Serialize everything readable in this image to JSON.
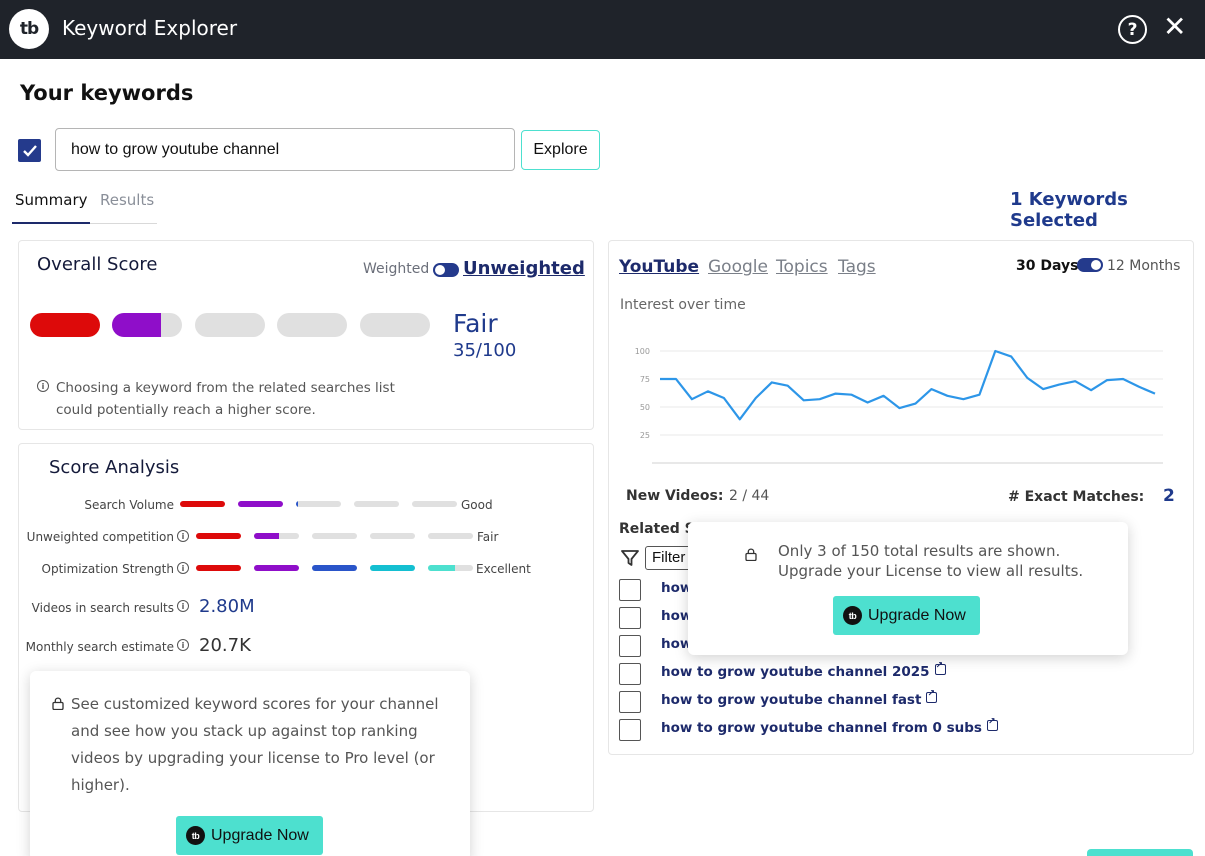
{
  "app": {
    "title": "Keyword Explorer",
    "logo_text": "tb"
  },
  "page": {
    "heading": "Your keywords"
  },
  "search": {
    "value": "how to grow youtube channel",
    "explore_label": "Explore"
  },
  "tabs": {
    "summary": "Summary",
    "results": "Results"
  },
  "keywords_selected": "1 Keywords Selected",
  "overall": {
    "title": "Overall Score",
    "weighted_label": "Weighted",
    "unweighted_label": "Unweighted",
    "rating": "Fair",
    "score": "35/100",
    "score_value": 35,
    "note": "Choosing a keyword from the related searches list could potentially reach a higher score.",
    "segment_fills": [
      1,
      0.7,
      0,
      0,
      0
    ],
    "segment_colors": [
      "#dd0a0a",
      "#8f0ec9",
      "#e0e0e0",
      "#e0e0e0",
      "#e0e0e0"
    ]
  },
  "score_analysis": {
    "title": "Score Analysis",
    "rows": [
      {
        "label": "Search Volume",
        "rating": "Good",
        "fills": [
          1,
          1,
          0.05,
          0,
          0
        ],
        "colors": [
          "#dd0a0a",
          "#8f0ec9",
          "#2a55c9",
          "#14bfd1",
          "#4de0cf"
        ]
      },
      {
        "label": "Unweighted competition",
        "rating": "Fair",
        "fills": [
          1,
          0.55,
          0,
          0,
          0
        ],
        "colors": [
          "#dd0a0a",
          "#8f0ec9",
          "#2a55c9",
          "#14bfd1",
          "#4de0cf"
        ]
      },
      {
        "label": "Optimization Strength",
        "rating": "Excellent",
        "fills": [
          1,
          1,
          1,
          1,
          0.6
        ],
        "colors": [
          "#dd0a0a",
          "#8f0ec9",
          "#2a55c9",
          "#14bfd1",
          "#4de0cf"
        ]
      }
    ],
    "videos_label": "Videos in search results",
    "videos_value": "2.80M",
    "monthly_label": "Monthly search estimate",
    "monthly_value": "20.7K"
  },
  "upsell_left": {
    "text": "See customized keyword scores for your channel and see how you stack up against top ranking videos by upgrading your license to Pro level (or higher).",
    "button": "Upgrade Now"
  },
  "right_panel": {
    "tabs": [
      "YouTube",
      "Google",
      "Topics",
      "Tags"
    ],
    "range_left": "30 Days",
    "range_right": "12 Months",
    "interest_label": "Interest over time",
    "new_videos_label": "New Videos:",
    "new_videos_value": "2 / 44",
    "exact_label": "# Exact Matches:",
    "exact_value": "2",
    "related_label": "Related S",
    "filter_placeholder": "Filter",
    "related_items": [
      "how",
      "how",
      "how",
      "how to grow youtube channel 2025",
      "how to grow youtube channel fast",
      "how to grow youtube channel from 0 subs"
    ]
  },
  "upsell_right": {
    "line1": "Only 3 of 150 total results are shown.",
    "line2": "Upgrade your License to view all results.",
    "button": "Upgrade Now"
  },
  "chart_data": {
    "type": "line",
    "title": "",
    "xlabel": "",
    "ylabel": "",
    "ylim": [
      0,
      100
    ],
    "yticks": [
      "25",
      "50",
      "75",
      "100"
    ],
    "grid": true,
    "series": [
      {
        "values": [
          75,
          75,
          57,
          64,
          58,
          39,
          58,
          72,
          69,
          56,
          57,
          62,
          61,
          54,
          60,
          49,
          53,
          66,
          60,
          57,
          61,
          100,
          95,
          76,
          66,
          70,
          73,
          65,
          74,
          75,
          68,
          62
        ]
      }
    ],
    "color": "#2d96e8"
  }
}
